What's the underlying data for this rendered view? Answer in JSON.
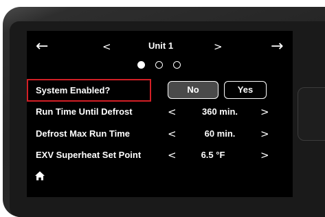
{
  "screen": {
    "title": "Unit 1",
    "icons": {
      "back": "arrow-left-icon",
      "forward": "arrow-right-icon",
      "prev": "chevron-left-icon",
      "next": "chevron-right-icon",
      "home": "home-icon"
    },
    "page_indicator": {
      "count": 3,
      "active_index": 0
    },
    "back_arrow": "←",
    "forward_arrow": "→",
    "prev_chevron": "<",
    "next_chevron": ">"
  },
  "settings": [
    {
      "label": "System Enabled?",
      "type": "toggle",
      "options": [
        "No",
        "Yes"
      ],
      "selected": "No",
      "highlighted": true,
      "highlight_color": "#d31f26"
    },
    {
      "label": "Run Time Until Defrost",
      "type": "stepper",
      "value": "360 min.",
      "decrement": "<",
      "increment": ">"
    },
    {
      "label": "Defrost Max Run Time",
      "type": "stepper",
      "value": "60 min.",
      "decrement": "<",
      "increment": ">"
    },
    {
      "label": "EXV Superheat Set Point",
      "type": "stepper",
      "value": "6.5 °F",
      "decrement": "<",
      "increment": ">"
    }
  ],
  "colors": {
    "screen_bg": "#000000",
    "text": "#ffffff",
    "selected_toggle_bg": "#4a4a4a",
    "highlight": "#d31f26"
  }
}
